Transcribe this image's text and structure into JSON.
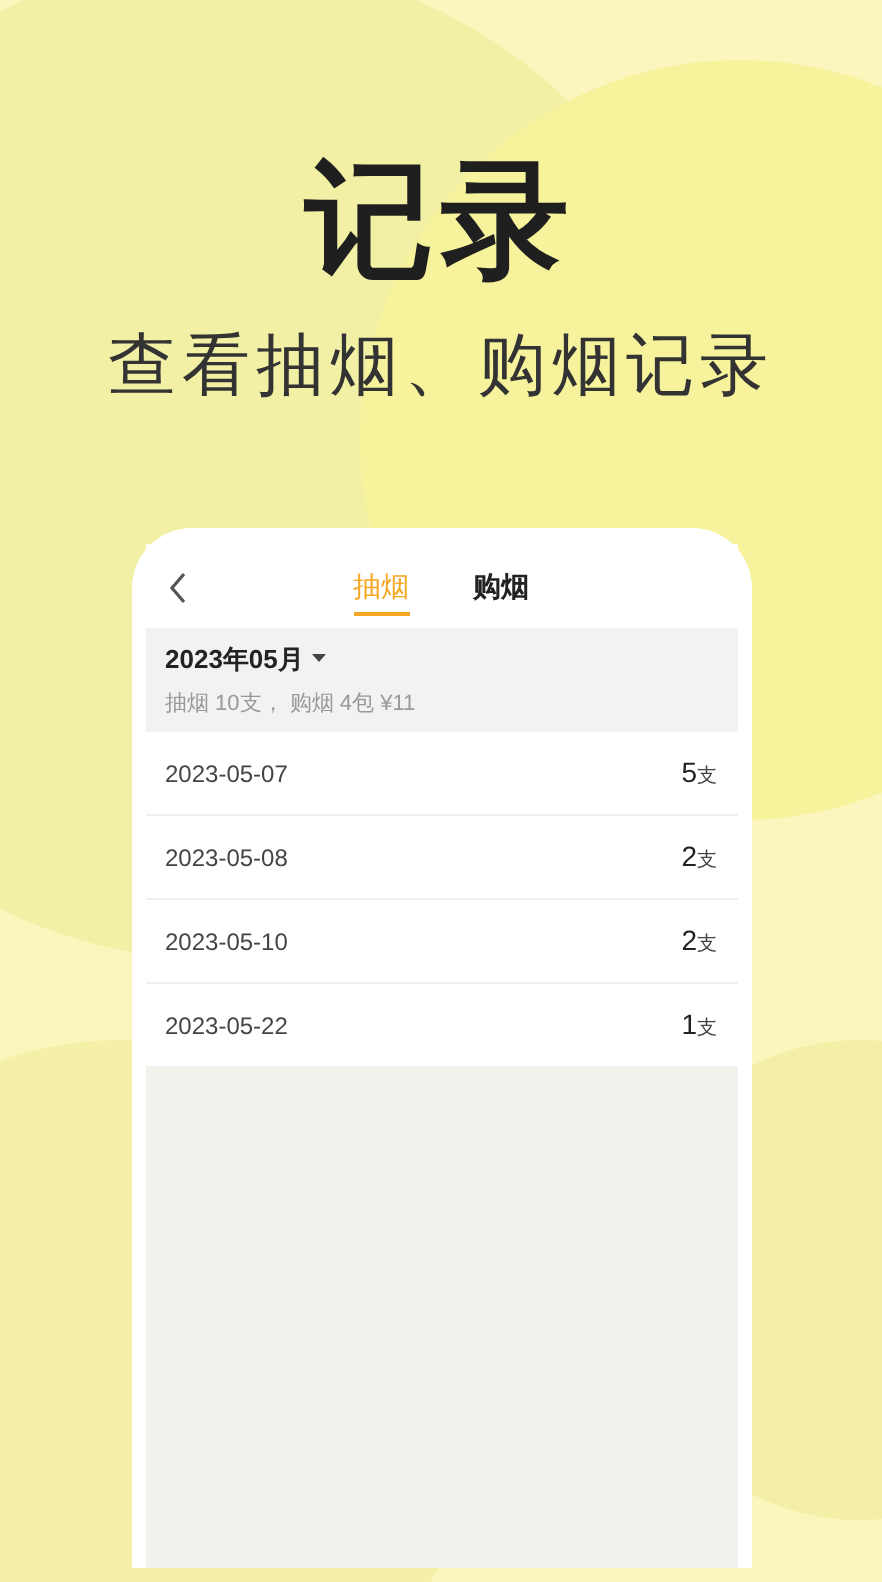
{
  "headline": "记录",
  "subtitle": "查看抽烟、购烟记录",
  "phone": {
    "tabs": [
      {
        "label": "抽烟",
        "selected": true
      },
      {
        "label": "购烟",
        "selected": false
      }
    ],
    "month": "2023年05月",
    "summary": "抽烟 10支， 购烟 4包 ¥11",
    "records": [
      {
        "date": "2023-05-07",
        "count": "5",
        "unit": "支"
      },
      {
        "date": "2023-05-08",
        "count": "2",
        "unit": "支"
      },
      {
        "date": "2023-05-10",
        "count": "2",
        "unit": "支"
      },
      {
        "date": "2023-05-22",
        "count": "1",
        "unit": "支"
      }
    ]
  }
}
